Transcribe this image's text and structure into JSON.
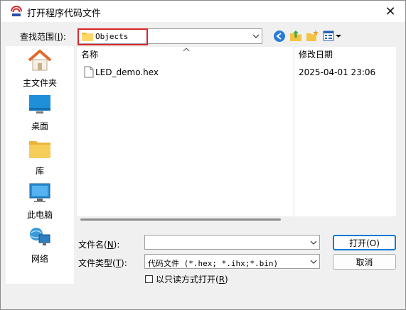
{
  "window": {
    "title": "打开程序代码文件",
    "close_glyph": "✕"
  },
  "lookin": {
    "label": "查找范围(",
    "accel": "I",
    "label_tail": "):",
    "value": "Objects",
    "highlight_color": "#d9262b"
  },
  "places": [
    {
      "label": "主文件夹",
      "icon": "home-icon"
    },
    {
      "label": "桌面",
      "icon": "desktop-icon"
    },
    {
      "label": "库",
      "icon": "library-icon"
    },
    {
      "label": "此电脑",
      "icon": "computer-icon"
    },
    {
      "label": "网络",
      "icon": "network-icon"
    }
  ],
  "filelist": {
    "columns": [
      "名称",
      "修改日期"
    ],
    "rows": [
      {
        "name": "LED_demo.hex",
        "modified": "2025-04-01 23:06"
      }
    ]
  },
  "filename": {
    "label": "文件名(",
    "accel": "N",
    "label_tail": "):",
    "value": ""
  },
  "filetype": {
    "label": "文件类型(",
    "accel": "T",
    "label_tail": "):",
    "value": "代码文件 (*.hex; *.ihx;*.bin)"
  },
  "readonly": {
    "label": "以只读方式打开(",
    "accel": "R",
    "label_tail": ")"
  },
  "buttons": {
    "open": "打开(O)",
    "cancel": "取消"
  },
  "colors": {
    "accent": "#0078d7",
    "folder": "#f5c342"
  }
}
